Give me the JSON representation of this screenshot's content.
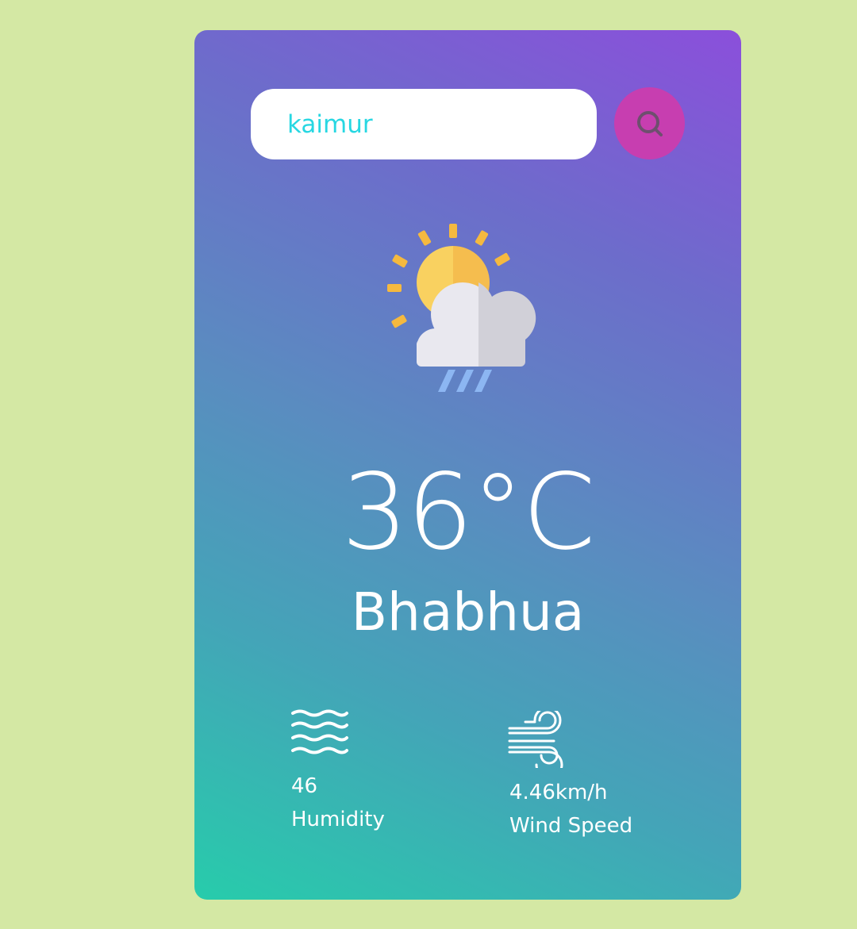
{
  "search": {
    "value": "kaimur",
    "placeholder": ""
  },
  "weather": {
    "icon": "sun-cloud-rain-icon",
    "temperature": "36°C",
    "city": "Bhabhua"
  },
  "details": {
    "humidity": {
      "icon": "waves-icon",
      "value": "46",
      "label": "Humidity"
    },
    "wind": {
      "icon": "wind-icon",
      "value": "4.46km/h",
      "label": "Wind Speed"
    }
  },
  "colors": {
    "page_background": "#d4e8a4",
    "card_gradient_start": "#8b4fdb",
    "card_gradient_end": "#27ccab",
    "search_button": "#c73eb0",
    "search_text": "#27d7e2",
    "text": "#ffffff"
  }
}
